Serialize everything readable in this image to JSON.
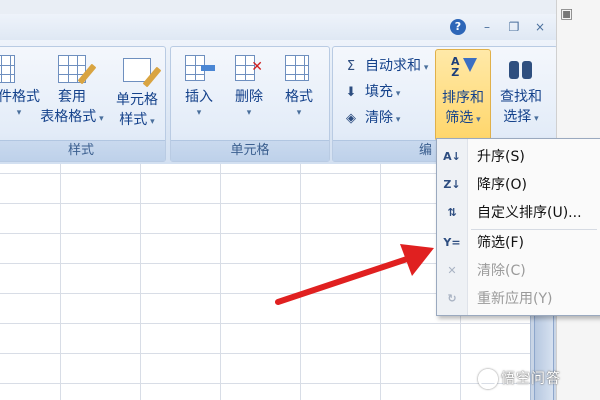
{
  "window": {
    "help_label": "?",
    "minimize_glyph": "–",
    "restore_glyph": "❐",
    "close_glyph": "×"
  },
  "ribbon": {
    "groups": [
      {
        "label": "样式",
        "buttons": [
          {
            "line1": "件格式",
            "line2": "·"
          },
          {
            "line1": "套用",
            "line2": "表格格式"
          },
          {
            "line1": "单元格",
            "line2": "样式"
          }
        ]
      },
      {
        "label": "单元格",
        "buttons": [
          {
            "line1": "插入"
          },
          {
            "line1": "删除"
          },
          {
            "line1": "格式"
          }
        ]
      },
      {
        "label": "编",
        "small": [
          {
            "icon": "Σ",
            "label": "自动求和"
          },
          {
            "icon": "⬇",
            "label": "填充"
          },
          {
            "icon": "◈",
            "label": "清除"
          }
        ],
        "buttons": [
          {
            "line1": "排序和",
            "line2": "筛选"
          },
          {
            "line1": "查找和",
            "line2": "选择"
          }
        ]
      }
    ]
  },
  "menu": {
    "items": [
      {
        "icon": "A↓",
        "label": "升序(S)",
        "disabled": false
      },
      {
        "icon": "Z↓",
        "label": "降序(O)",
        "disabled": false
      },
      {
        "icon": "⇅",
        "label": "自定义排序(U)...",
        "disabled": false
      },
      {
        "icon": "Y=",
        "label": "筛选(F)",
        "disabled": false
      },
      {
        "icon": "✕",
        "label": "清除(C)",
        "disabled": true
      },
      {
        "icon": "↻",
        "label": "重新应用(Y)",
        "disabled": true
      }
    ]
  },
  "watermark": {
    "text": "悟空问答"
  },
  "colors": {
    "accent": "#15428b",
    "arrow": "#e02020",
    "ribbon_bg": "#dde7f4"
  }
}
